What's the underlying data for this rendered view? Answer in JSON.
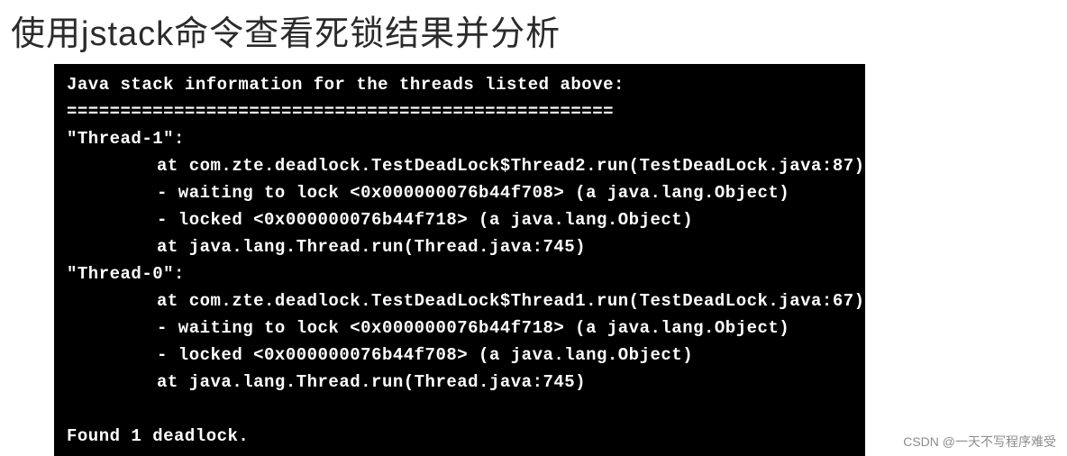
{
  "title": "使用jstack命令查看死锁结果并分析",
  "terminal": {
    "header": "Java stack information for the threads listed above:",
    "divider": "===================================================",
    "threads": [
      {
        "name": "\"Thread-1\":",
        "lines": [
          "at com.zte.deadlock.TestDeadLock$Thread2.run(TestDeadLock.java:87)",
          "- waiting to lock <0x000000076b44f708> (a java.lang.Object)",
          "- locked <0x000000076b44f718> (a java.lang.Object)",
          "at java.lang.Thread.run(Thread.java:745)"
        ]
      },
      {
        "name": "\"Thread-0\":",
        "lines": [
          "at com.zte.deadlock.TestDeadLock$Thread1.run(TestDeadLock.java:67)",
          "- waiting to lock <0x000000076b44f718> (a java.lang.Object)",
          "- locked <0x000000076b44f708> (a java.lang.Object)",
          "at java.lang.Thread.run(Thread.java:745)"
        ]
      }
    ],
    "blank": " ",
    "footer": "Found 1 deadlock."
  },
  "watermark": "CSDN @一天不写程序难受"
}
